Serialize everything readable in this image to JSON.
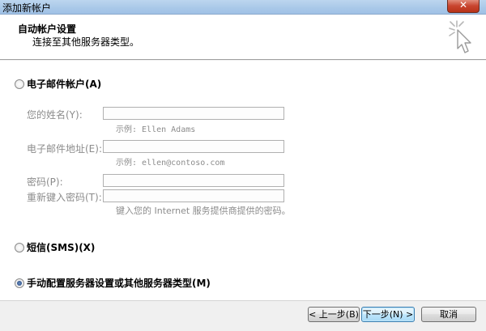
{
  "window": {
    "title": "添加新帐户",
    "close_label": "✕"
  },
  "header": {
    "title": "自动帐户设置",
    "subtitle": "连接至其他服务器类型。"
  },
  "options": {
    "email_account": {
      "label": "电子邮件帐户(A)",
      "checked": false
    },
    "sms": {
      "label": "短信(SMS)(X)",
      "checked": false
    },
    "manual": {
      "label": "手动配置服务器设置或其他服务器类型(M)",
      "checked": true
    }
  },
  "fields": {
    "name": {
      "label": "您的姓名(Y):",
      "value": "",
      "hint": "示例: Ellen Adams"
    },
    "email": {
      "label": "电子邮件地址(E):",
      "value": "",
      "hint": "示例: ellen@contoso.com"
    },
    "password": {
      "label": "密码(P):",
      "value": ""
    },
    "retype_password": {
      "label": "重新键入密码(T):",
      "value": "",
      "hint": "键入您的 Internet 服务提供商提供的密码。"
    }
  },
  "footer": {
    "back_label": "< 上一步(B)",
    "next_label": "下一步(N) >",
    "cancel_label": "取消"
  }
}
